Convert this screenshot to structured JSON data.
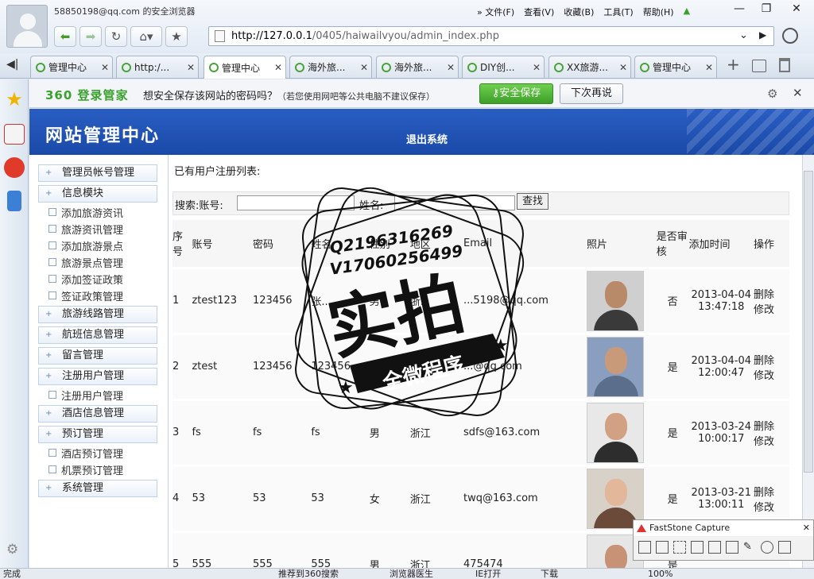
{
  "browser": {
    "account": "58850198@qq.com 的安全浏览器",
    "menus": [
      "» 文件(F)",
      "查看(V)",
      "收藏(B)",
      "工具(T)",
      "帮助(H)"
    ],
    "url_prefix": "http://127.0.0.1",
    "url_path": "/0405/haiwailvyou/admin_index.php"
  },
  "tabs": [
    {
      "label": "管理中心"
    },
    {
      "label": "http:/..."
    },
    {
      "label": "管理中心"
    },
    {
      "label": "海外旅..."
    },
    {
      "label": "海外旅..."
    },
    {
      "label": "DIY创..."
    },
    {
      "label": "XX旅游..."
    },
    {
      "label": "管理中心"
    }
  ],
  "password_bar": {
    "logo": "360 登录管家",
    "question": "想安全保存该网站的密码吗？",
    "note": "（若您使用网吧等公共电脑不建议保存）",
    "save": "安全保存",
    "later": "下次再说"
  },
  "banner": {
    "title": "网站管理中心",
    "logout": "退出系统"
  },
  "sidebar": {
    "items": [
      {
        "label": "管理员帐号管理",
        "type": "parent"
      },
      {
        "label": "信息模块",
        "type": "parent"
      },
      {
        "label": "添加旅游资讯",
        "type": "child"
      },
      {
        "label": "旅游资讯管理",
        "type": "child"
      },
      {
        "label": "添加旅游景点",
        "type": "child"
      },
      {
        "label": "旅游景点管理",
        "type": "child"
      },
      {
        "label": "添加签证政策",
        "type": "child"
      },
      {
        "label": "签证政策管理",
        "type": "child"
      },
      {
        "label": "旅游线路管理",
        "type": "parent"
      },
      {
        "label": "航班信息管理",
        "type": "parent"
      },
      {
        "label": "留言管理",
        "type": "parent"
      },
      {
        "label": "注册用户管理",
        "type": "parent"
      },
      {
        "label": "注册用户管理",
        "type": "child"
      },
      {
        "label": "酒店信息管理",
        "type": "parent"
      },
      {
        "label": "预订管理",
        "type": "parent"
      },
      {
        "label": "酒店预订管理",
        "type": "child"
      },
      {
        "label": "机票预订管理",
        "type": "child"
      },
      {
        "label": "系统管理",
        "type": "parent"
      }
    ]
  },
  "main": {
    "list_title": "已有用户注册列表:",
    "search": {
      "account_label": "搜索:账号:",
      "name_label": "姓名:",
      "button": "查找"
    },
    "columns": [
      "序号",
      "账号",
      "密码",
      "姓名",
      "性别",
      "地区",
      "Email",
      "照片",
      "是否审核",
      "添加时间",
      "操作"
    ],
    "rows": [
      {
        "no": "1",
        "account": "ztest123",
        "password": "123456",
        "name": "张...",
        "gender": "男",
        "region": "浙...",
        "email": "...5198@qq.com",
        "audited": "否",
        "date": "2013-04-04",
        "time": "13:47:18",
        "del": "删除",
        "edit": "修改"
      },
      {
        "no": "2",
        "account": "ztest",
        "password": "123456",
        "name": "123456",
        "gender": "男",
        "region": "",
        "email": "...@qq.com",
        "audited": "是",
        "date": "2013-04-04",
        "time": "12:00:47",
        "del": "删除",
        "edit": "修改"
      },
      {
        "no": "3",
        "account": "fs",
        "password": "fs",
        "name": "fs",
        "gender": "男",
        "region": "浙江",
        "email": "sdfs@163.com",
        "audited": "是",
        "date": "2013-03-24",
        "time": "10:00:17",
        "del": "删除",
        "edit": "修改"
      },
      {
        "no": "4",
        "account": "53",
        "password": "53",
        "name": "53",
        "gender": "女",
        "region": "浙江",
        "email": "twq@163.com",
        "audited": "是",
        "date": "2013-03-21",
        "time": "13:00:11",
        "del": "删除",
        "edit": "修改"
      },
      {
        "no": "5",
        "account": "555",
        "password": "555",
        "name": "555",
        "gender": "男",
        "region": "浙江",
        "email": "475474",
        "audited": "是",
        "date": "",
        "time": "",
        "del": "",
        "edit": ""
      }
    ]
  },
  "stamp": {
    "line1": "Q2196316269",
    "line2": "V17060256499",
    "big": "实拍",
    "ribbon": "全微程序"
  },
  "faststone": {
    "title": "FastStone Capture"
  },
  "status": {
    "left": "完成",
    "items": [
      "推荐到360搜索",
      "浏览器医生",
      "IE打开",
      "下载",
      "100%"
    ]
  },
  "colors": {
    "banner": "#1a4aa8",
    "save_button": "#3c9f28"
  }
}
